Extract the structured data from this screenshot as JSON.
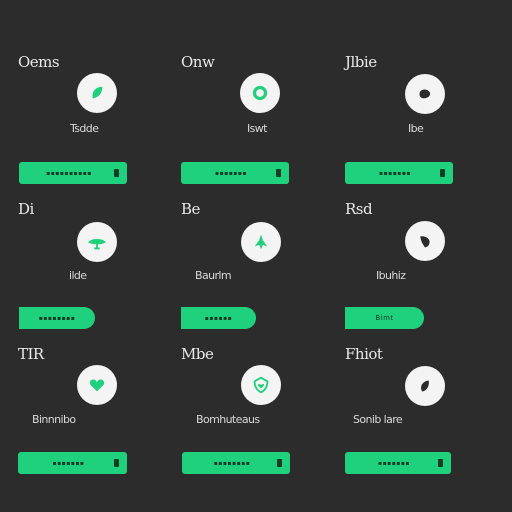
{
  "accent_color": "#1fd17c",
  "background_color": "#2c2c2c",
  "cards": [
    {
      "title": "Oems",
      "caption": "Tsdde",
      "button_label": "▪▪▪▪▪▪▪▪▪▪",
      "icon": "leaf-icon"
    },
    {
      "title": "Onw",
      "caption": "Iswt",
      "button_label": "▪▪▪▪▪▪▪",
      "icon": "ring-icon"
    },
    {
      "title": "Jlbie",
      "caption": "Ibe",
      "button_label": "▪▪▪▪▪▪▪",
      "icon": "blob-icon"
    },
    {
      "title": "Di",
      "caption": "ilde",
      "button_label": "▪▪▪▪▪▪▪▪",
      "icon": "plant-icon"
    },
    {
      "title": "Be",
      "caption": "Baurlm",
      "button_label": "▪▪▪▪▪▪",
      "icon": "figure-icon"
    },
    {
      "title": "Rsd",
      "caption": "Ibuhiz",
      "button_label": "Bimt",
      "icon": "leaf-outline-icon"
    },
    {
      "title": "TIR",
      "caption": "Binnnibo",
      "button_label": "▪▪▪▪▪▪▪",
      "icon": "heart-icon"
    },
    {
      "title": "Mbe",
      "caption": "Bomhuteaus",
      "button_label": "▪▪▪▪▪▪▪▪",
      "icon": "heart-shield-icon"
    },
    {
      "title": "Fhiot",
      "caption": "Sonib lare",
      "button_label": "▪▪▪▪▪▪▪",
      "icon": "leaf-drop-icon"
    }
  ]
}
